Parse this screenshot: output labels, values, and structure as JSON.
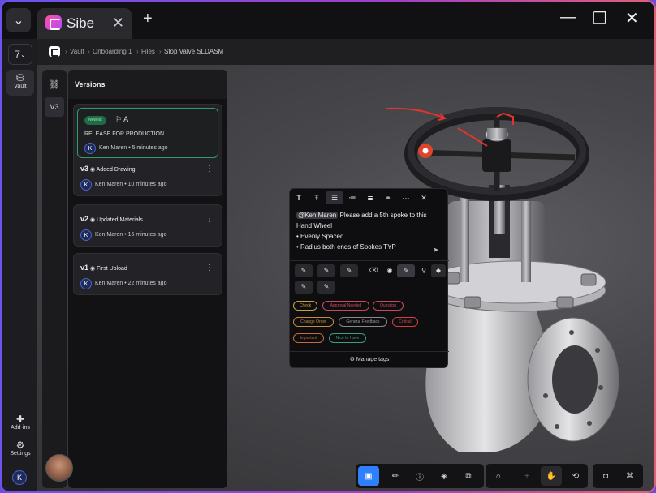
{
  "app": {
    "title": "Sibe"
  },
  "rail": {
    "version_selector": "7",
    "vault": "Vault",
    "addins": "Add-ins",
    "settings": "Settings",
    "user_initial": "K"
  },
  "breadcrumb": [
    "Vault",
    "Onboarding 1",
    "Files",
    "Stop Valve.SLDASM"
  ],
  "side_tabs": {
    "v3": "V3"
  },
  "versions": {
    "title": "Versions",
    "newest": {
      "badge": "Newest",
      "flag": "A",
      "note": "RELEASE FOR PRODUCTION",
      "user": "Ken Maren",
      "time": "5 minutes ago"
    },
    "items": [
      {
        "version": "v3",
        "title": "Added Drawing",
        "user": "Ken Maren",
        "time": "10 minutes ago",
        "initial": "K"
      },
      {
        "version": "v2",
        "title": "Updated Materials",
        "user": "Ken Maren",
        "time": "15 minutes ago",
        "initial": "K"
      },
      {
        "version": "v1",
        "title": "First Upload",
        "user": "Ken Maren",
        "time": "22 minutes ago",
        "initial": "K"
      }
    ]
  },
  "comment": {
    "mention": "@Ken Maren",
    "text": "Please add a 5th spoke to this Hand Wheel",
    "bullets": [
      "Evenly Spaced",
      "Radius both ends of Spokes TYP"
    ],
    "tags": [
      {
        "label": "Check",
        "color": "#c9a23a"
      },
      {
        "label": "Approval Needed",
        "color": "#c94a5a"
      },
      {
        "label": "Question",
        "color": "#c94a5a"
      },
      {
        "label": "Change Order",
        "color": "#c98a3a"
      },
      {
        "label": "General Feedback",
        "color": "#8a8a8a"
      },
      {
        "label": "Critical",
        "color": "#d04040"
      },
      {
        "label": "Important",
        "color": "#c96a3a"
      },
      {
        "label": "Nice to Have",
        "color": "#3aa07a"
      }
    ],
    "manage_tags": "Manage tags"
  },
  "colors": {
    "accent": "#2f80ff",
    "annotation": "#e0342c"
  }
}
